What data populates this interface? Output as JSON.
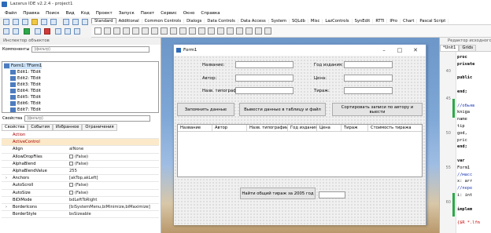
{
  "app": {
    "title": "Lazarus IDE v2.2.4 - project1"
  },
  "menu": [
    "Файл",
    "Правка",
    "Поиск",
    "Вид",
    "Код",
    "Проект",
    "Запуск",
    "Пакет",
    "Сервис",
    "Окно",
    "Справка"
  ],
  "palette_tabs": [
    "Standard",
    "Additional",
    "Common Controls",
    "Dialogs",
    "Data Controls",
    "Data Access",
    "System",
    "SQLdb",
    "Misc",
    "LazControls",
    "SynEdit",
    "RTTI",
    "IPro",
    "Chart",
    "Pascal Script"
  ],
  "palette_active": "Standard",
  "inspector": {
    "title": "Инспектор объектов",
    "components_label": "Компоненты",
    "filter_placeholder": "(фильтр)",
    "tree": [
      "Form1: TForm1",
      "Edit1: TEdit",
      "Edit2: TEdit",
      "Edit3: TEdit",
      "Edit4: TEdit",
      "Edit5: TEdit",
      "Edit6: TEdit",
      "Edit7: TEdit"
    ],
    "props_label": "Свойства",
    "tabs": [
      "Свойства",
      "События",
      "Избранное",
      "Ограничения"
    ],
    "properties": [
      {
        "name": "Action",
        "value": "",
        "red": true
      },
      {
        "name": "ActiveControl",
        "value": "",
        "red": true,
        "hl": true
      },
      {
        "name": "Align",
        "value": "alNone"
      },
      {
        "name": "AllowDropFiles",
        "value": "(False)",
        "checkbox": true
      },
      {
        "name": "AlphaBlend",
        "value": "(False)",
        "checkbox": true
      },
      {
        "name": "AlphaBlendValue",
        "value": "255"
      },
      {
        "name": "Anchors",
        "value": "[akTop,akLeft]",
        "expand": true
      },
      {
        "name": "AutoScroll",
        "value": "(False)",
        "checkbox": true
      },
      {
        "name": "AutoSize",
        "value": "(False)",
        "checkbox": true
      },
      {
        "name": "BiDiMode",
        "value": "bdLeftToRight"
      },
      {
        "name": "BorderIcons",
        "value": "[biSystemMenu,biMinimize,biMaximize]",
        "expand": true
      },
      {
        "name": "BorderStyle",
        "value": "bsSizeable"
      }
    ]
  },
  "form": {
    "title": "Form1",
    "labels": {
      "name": "Название:",
      "year": "Год издания:",
      "author": "Автор:",
      "price": "Цена:",
      "publisher": "Назв. типографии:",
      "circulation": "Тираж:"
    },
    "buttons": {
      "save": "Запомнить данные",
      "output": "Вывести данные в таблицу и файл",
      "sort": "Сортировать записи по автору и выести"
    },
    "grid_columns": [
      "Название",
      "Автор",
      "Назв. типографии",
      "Год издания",
      "Цена",
      "Тираж",
      "Стоимость тиража"
    ],
    "find_button": "Найти общий тираж за 2005 год"
  },
  "editor": {
    "title": "Редактор исходного",
    "tabs": [
      "*Unit1",
      "Grids"
    ],
    "lines": [
      {
        "ln": "",
        "text": "proc",
        "kw": true
      },
      {
        "ln": "",
        "text": "private",
        "kw": true
      },
      {
        "ln": "40",
        "text": ""
      },
      {
        "ln": "",
        "text": "public",
        "kw": true
      },
      {
        "ln": "",
        "text": ""
      },
      {
        "ln": "",
        "text": "end;",
        "kw": true
      },
      {
        "ln": "45",
        "text": ""
      },
      {
        "ln": "",
        "text": "//обьяв",
        "cm": true
      },
      {
        "ln": "",
        "text": "kniga"
      },
      {
        "ln": "",
        "text": "  name"
      },
      {
        "ln": "",
        "text": "  tip"
      },
      {
        "ln": "50",
        "text": "  god,"
      },
      {
        "ln": "",
        "text": "  pric"
      },
      {
        "ln": "",
        "text": "end;",
        "kw": true
      },
      {
        "ln": "",
        "text": ""
      },
      {
        "ln": "",
        "text": "var",
        "kw": true
      },
      {
        "ln": "55",
        "text": "  Form1"
      },
      {
        "ln": "",
        "text": "//масс",
        "cm": true
      },
      {
        "ln": "",
        "text": "x: arr"
      },
      {
        "ln": "",
        "text": "//пере",
        "cm": true
      },
      {
        "ln": "",
        "text": "i: int"
      },
      {
        "ln": "60",
        "text": ""
      },
      {
        "ln": "",
        "text": "implem",
        "kw": true
      },
      {
        "ln": "",
        "text": ""
      },
      {
        "ln": "",
        "text": "{$R *.lfm",
        "red": true
      }
    ]
  }
}
